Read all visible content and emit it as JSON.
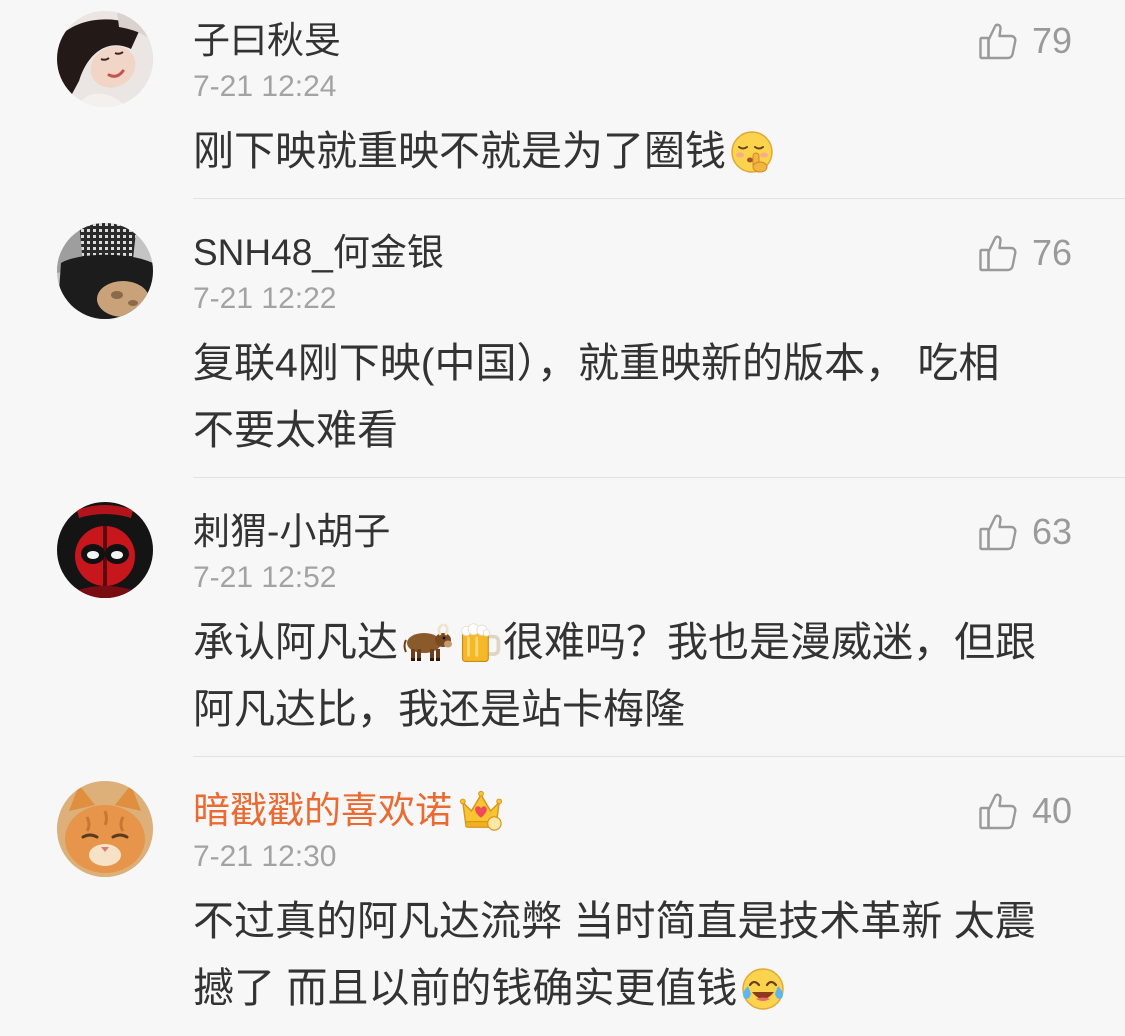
{
  "colors": {
    "background": "#f7f7f7",
    "text": "#333333",
    "muted": "#a3a3a3",
    "vip_name": "#eb6a32",
    "divider": "#e3e3e3",
    "icon": "#9a9a9a"
  },
  "like_icon": "thumbs-up-icon",
  "comments": [
    {
      "username": "子曰秋旻",
      "time": "7-21 12:24",
      "likes": "79",
      "content": [
        {
          "text": "刚下映就重映不就是为了圈钱"
        },
        {
          "emoji": "shush-emoji-icon"
        }
      ]
    },
    {
      "username": "SNH48_何金银",
      "time": "7-21 12:22",
      "likes": "76",
      "content": [
        {
          "text": "复联4刚下映(中国），就重映新的版本， 吃相"
        },
        {
          "text": "不要太难看"
        }
      ]
    },
    {
      "username": "刺猬-小胡子",
      "time": "7-21 12:52",
      "likes": "63",
      "content": [
        {
          "text": "承认阿凡达"
        },
        {
          "emoji": "ox-emoji-icon"
        },
        {
          "emoji": "beer-emoji-icon"
        },
        {
          "text": "很难吗？我也是漫威迷，但跟"
        },
        {
          "text": "阿凡达比，我还是站卡梅隆"
        }
      ]
    },
    {
      "username": "暗戳戳的喜欢诺",
      "username_badge": "crown-fan-badge-icon",
      "time": "7-21 12:30",
      "likes": "40",
      "content": [
        {
          "text": "不过真的阿凡达流弊 当时简直是技术革新 太震"
        },
        {
          "text": "撼了 而且以前的钱确实更值钱"
        },
        {
          "emoji": "laugh-cry-emoji-icon"
        }
      ]
    }
  ]
}
